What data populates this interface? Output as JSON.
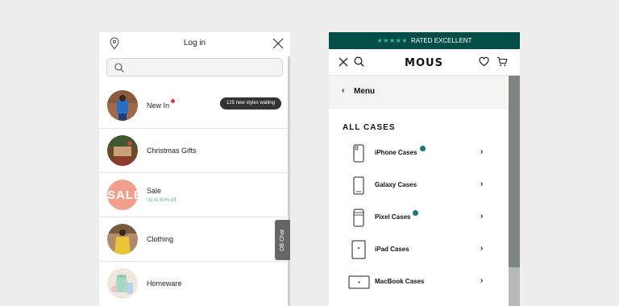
{
  "left_panel": {
    "header": {
      "title": "Log in"
    },
    "search": {
      "placeholder": ""
    },
    "categories": [
      {
        "label": "New In",
        "badge": "125 new styles waiting"
      },
      {
        "label": "Christmas Gifts"
      },
      {
        "label": "Sale",
        "sublabel": "Up to 60% off",
        "thumb_text": "SALE"
      },
      {
        "label": "Clothing"
      },
      {
        "label": "Homeware"
      }
    ],
    "chat_tab": "OB Chat"
  },
  "right_panel": {
    "banner": {
      "stars": "★★★★★",
      "text": "RATED EXCELLENT"
    },
    "logo_text": "MOUS",
    "menu": {
      "back": "‹",
      "label": "Menu"
    },
    "section_title": "ALL CASES",
    "cases": [
      {
        "label": "iPhone Cases",
        "icon": "iphone-icon",
        "new_dot": true
      },
      {
        "label": "Galaxy Cases",
        "icon": "galaxy-icon",
        "new_dot": false
      },
      {
        "label": "Pixel Cases",
        "icon": "pixel-icon",
        "new_dot": true
      },
      {
        "label": "iPad Cases",
        "icon": "ipad-icon",
        "new_dot": false
      },
      {
        "label": "MacBook Cases",
        "icon": "macbook-icon",
        "new_dot": false
      }
    ],
    "chevron": "›"
  },
  "colors": {
    "background": "#ededed",
    "banner": "#054e48",
    "stars": "#35c0a8",
    "new_dot_red": "#e2323b",
    "new_dot_teal": "#147a6b",
    "sale_text": "#5fa89a"
  }
}
